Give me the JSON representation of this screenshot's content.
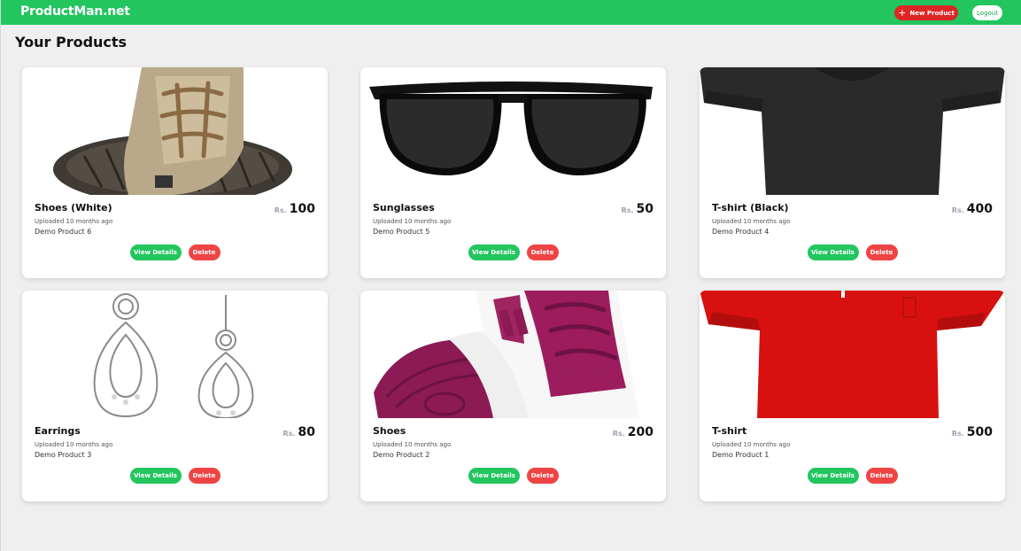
{
  "app": {
    "brand": "ProductMan.net"
  },
  "header": {
    "new_product_label": "New Product",
    "logout_label": "Logout"
  },
  "page": {
    "title": "Your Products"
  },
  "colors": {
    "primary": "#22c55e",
    "danger": "#dc2626",
    "background": "#efefef"
  },
  "currency": "Rs.",
  "products": [
    {
      "name": "Shoes (White)",
      "uploaded": "Uploaded 10 months ago",
      "description": "Demo Product 6",
      "price": "100",
      "view_label": "View Details",
      "delete_label": "Delete"
    },
    {
      "name": "Sunglasses",
      "uploaded": "Uploaded 10 months ago",
      "description": "Demo Product 5",
      "price": "50",
      "view_label": "View Details",
      "delete_label": "Delete"
    },
    {
      "name": "T-shirt (Black)",
      "uploaded": "Uploaded 10 months ago",
      "description": "Demo Product 4",
      "price": "400",
      "view_label": "View Details",
      "delete_label": "Delete"
    },
    {
      "name": "Earrings",
      "uploaded": "Uploaded 10 months ago",
      "description": "Demo Product 3",
      "price": "80",
      "view_label": "View Details",
      "delete_label": "Delete"
    },
    {
      "name": "Shoes",
      "uploaded": "Uploaded 10 months ago",
      "description": "Demo Product 2",
      "price": "200",
      "view_label": "View Details",
      "delete_label": "Delete"
    },
    {
      "name": "T-shirt",
      "uploaded": "Uploaded 10 months ago",
      "description": "Demo Product 1",
      "price": "500",
      "view_label": "View Details",
      "delete_label": "Delete"
    }
  ]
}
